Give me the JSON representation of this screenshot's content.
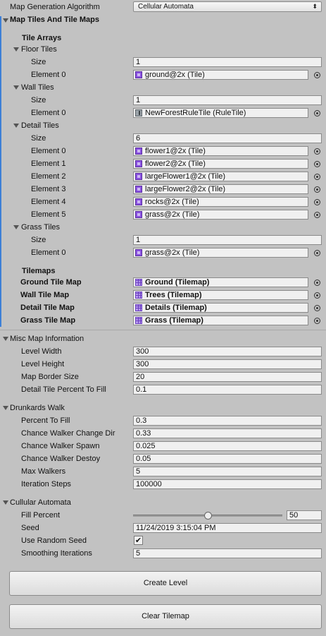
{
  "generation_algorithm": {
    "label": "Map Generation Algorithm",
    "value": "Cellular Automata"
  },
  "map_tiles": {
    "header": "Map Tiles And Tile Maps",
    "tile_arrays_label": "Tile Arrays",
    "floor": {
      "label": "Floor Tiles",
      "size_label": "Size",
      "size": "1",
      "elements": [
        {
          "label": "Element 0",
          "value": "ground@2x (Tile)"
        }
      ]
    },
    "wall": {
      "label": "Wall Tiles",
      "size_label": "Size",
      "size": "1",
      "elements": [
        {
          "label": "Element 0",
          "value": "NewForestRuleTile (RuleTile)"
        }
      ]
    },
    "detail": {
      "label": "Detail Tiles",
      "size_label": "Size",
      "size": "6",
      "elements": [
        {
          "label": "Element 0",
          "value": "flower1@2x (Tile)"
        },
        {
          "label": "Element 1",
          "value": "flower2@2x (Tile)"
        },
        {
          "label": "Element 2",
          "value": "largeFlower1@2x (Tile)"
        },
        {
          "label": "Element 3",
          "value": "largeFlower2@2x (Tile)"
        },
        {
          "label": "Element 4",
          "value": "rocks@2x (Tile)"
        },
        {
          "label": "Element 5",
          "value": "grass@2x (Tile)"
        }
      ]
    },
    "grass": {
      "label": "Grass Tiles",
      "size_label": "Size",
      "size": "1",
      "elements": [
        {
          "label": "Element 0",
          "value": "grass@2x (Tile)"
        }
      ]
    },
    "tilemaps_label": "Tilemaps",
    "tilemaps": [
      {
        "label": "Ground Tile Map",
        "value": "Ground (Tilemap)"
      },
      {
        "label": "Wall Tile Map",
        "value": "Trees (Tilemap)"
      },
      {
        "label": "Detail Tile Map",
        "value": "Details (Tilemap)"
      },
      {
        "label": "Grass Tile Map",
        "value": "Grass (Tilemap)"
      }
    ]
  },
  "misc": {
    "header": "Misc Map Information",
    "rows": [
      {
        "label": "Level Width",
        "value": "300"
      },
      {
        "label": "Level Height",
        "value": "300"
      },
      {
        "label": "Map Border Size",
        "value": "20"
      },
      {
        "label": "Detail Tile Percent To Fill",
        "value": "0.1"
      }
    ]
  },
  "drunkards": {
    "header": "Drunkards Walk",
    "rows": [
      {
        "label": "Percent To Fill",
        "value": "0.3"
      },
      {
        "label": "Chance Walker Change Dir",
        "value": "0.33"
      },
      {
        "label": "Chance Walker Spawn",
        "value": "0.025"
      },
      {
        "label": "Chance Walker Destoy",
        "value": "0.05"
      },
      {
        "label": "Max Walkers",
        "value": "5"
      },
      {
        "label": "Iteration Steps",
        "value": "100000"
      }
    ]
  },
  "cellular": {
    "header": "Cullular Automata",
    "fill_percent_label": "Fill Percent",
    "fill_percent": "50",
    "fill_percent_fraction": 0.5,
    "seed_label": "Seed",
    "seed": "11/24/2019 3:15:04 PM",
    "use_random_label": "Use Random Seed",
    "use_random": true,
    "smoothing_label": "Smoothing Iterations",
    "smoothing": "5"
  },
  "buttons": {
    "create": "Create Level",
    "clear": "Clear Tilemap"
  },
  "icons": {
    "tile": "tile-asset-icon",
    "ruletile": "rule-tile-icon",
    "tilemap": "tilemap-icon",
    "object_picker": "object-picker-icon",
    "foldout": "foldout-arrow-icon"
  },
  "colors": {
    "background": "#c2c2c2",
    "field": "#f0f0f0",
    "tile_icon": "#8a52e0",
    "selection_bar": "#3d7fd6"
  }
}
